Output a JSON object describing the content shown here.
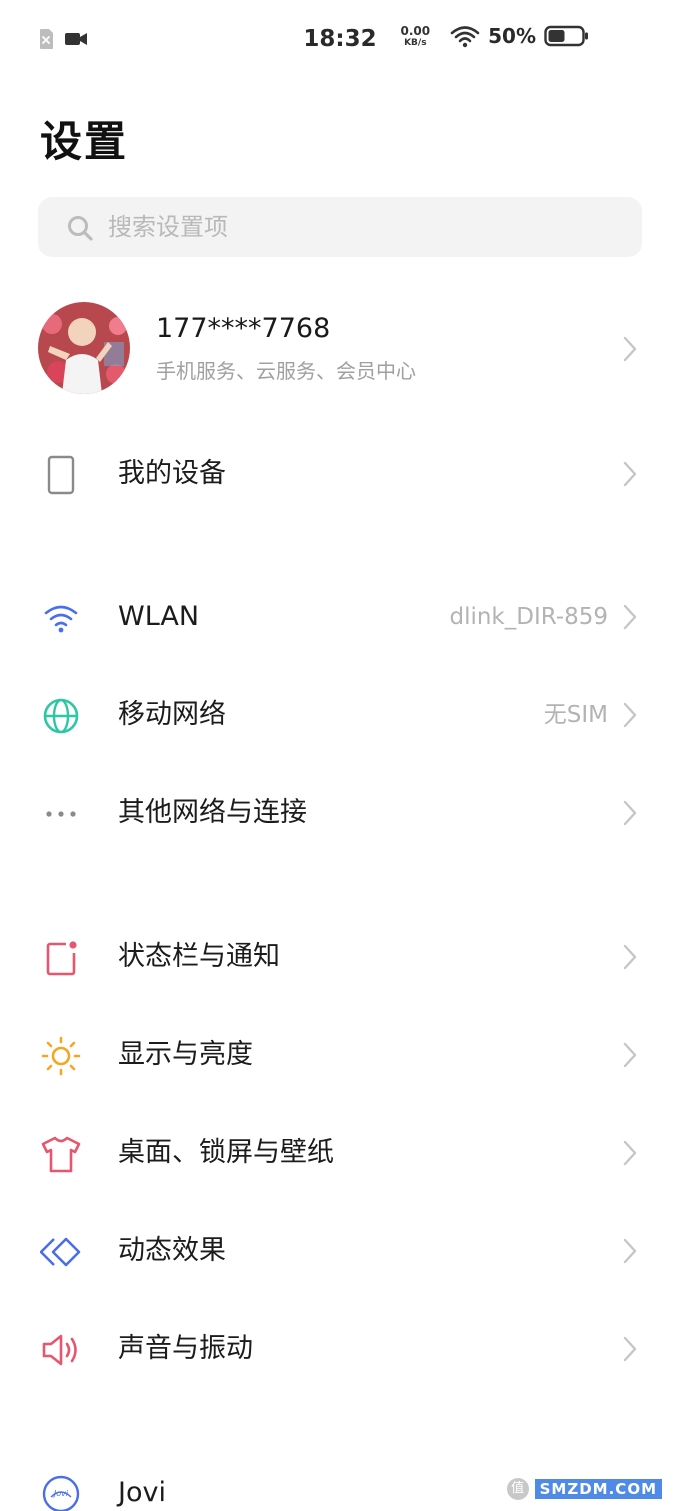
{
  "status_bar": {
    "time": "18:32",
    "speed_value": "0.00",
    "speed_unit": "KB/s",
    "battery_percent": "50%",
    "battery_level": 0.5
  },
  "title": "设置",
  "search": {
    "placeholder": "搜索设置项"
  },
  "account": {
    "name": "177****7768",
    "subtitle": "手机服务、云服务、会员中心"
  },
  "rows": [
    {
      "label": "我的设备",
      "value": "",
      "icon": "phone-device-icon",
      "color": "#8a8a8a"
    },
    {
      "label": "WLAN",
      "value": "dlink_DIR-859",
      "icon": "wifi-icon",
      "color": "#4a6ee8"
    },
    {
      "label": "移动网络",
      "value": "无SIM",
      "icon": "globe-icon",
      "color": "#2cc7a3"
    },
    {
      "label": "其他网络与连接",
      "value": "",
      "icon": "more-dots-icon",
      "color": "#8a8a8a"
    },
    {
      "label": "状态栏与通知",
      "value": "",
      "icon": "notification-icon",
      "color": "#e8566e"
    },
    {
      "label": "显示与亮度",
      "value": "",
      "icon": "sun-icon",
      "color": "#f5a623"
    },
    {
      "label": "桌面、锁屏与壁纸",
      "value": "",
      "icon": "tshirt-icon",
      "color": "#e8566e"
    },
    {
      "label": "动态效果",
      "value": "",
      "icon": "diamond-icon",
      "color": "#4a6ee8"
    },
    {
      "label": "声音与振动",
      "value": "",
      "icon": "speaker-icon",
      "color": "#e8566e"
    },
    {
      "label": "Jovi",
      "value": "",
      "icon": "jovi-icon",
      "color": "#4a6ee8"
    }
  ],
  "watermark": {
    "badge": "值",
    "text": "SMZDM.COM"
  }
}
